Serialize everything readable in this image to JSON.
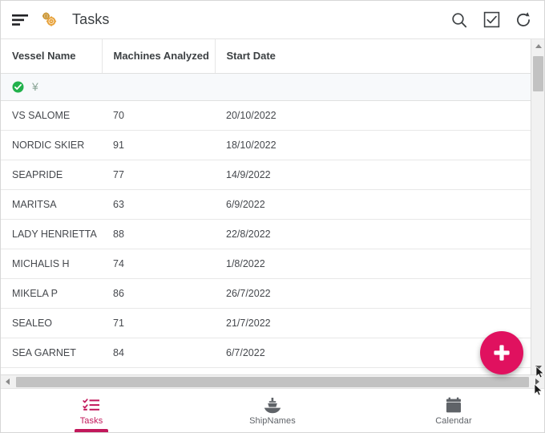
{
  "app_bar": {
    "title": "Tasks",
    "menu_icon": "sort-menu-icon",
    "logo_icon": "gears-icon",
    "actions": [
      {
        "name": "search-icon",
        "label": "Search"
      },
      {
        "name": "select-checkbox-icon",
        "label": "Select"
      },
      {
        "name": "refresh-icon",
        "label": "Refresh"
      }
    ]
  },
  "table": {
    "columns": [
      "Vessel Name",
      "Machines Analyzed",
      "Start Date"
    ],
    "filter_row": {
      "status_icon": "check-circle-icon",
      "currency_symbol": "¥"
    },
    "rows": [
      {
        "vessel": "VS SALOME",
        "machines": "70",
        "date": "20/10/2022"
      },
      {
        "vessel": "NORDIC SKIER",
        "machines": "91",
        "date": "18/10/2022"
      },
      {
        "vessel": "SEAPRIDE",
        "machines": "77",
        "date": "14/9/2022"
      },
      {
        "vessel": "MARITSA",
        "machines": "63",
        "date": "6/9/2022"
      },
      {
        "vessel": "LADY HENRIETTA",
        "machines": "88",
        "date": "22/8/2022"
      },
      {
        "vessel": "MICHALIS H",
        "machines": "74",
        "date": "1/8/2022"
      },
      {
        "vessel": "MIKELA P",
        "machines": "86",
        "date": "26/7/2022"
      },
      {
        "vessel": "SEALEO",
        "machines": "71",
        "date": "21/7/2022"
      },
      {
        "vessel": "SEA GARNET",
        "machines": "84",
        "date": "6/7/2022"
      }
    ]
  },
  "fab": {
    "name": "add-task-fab",
    "label": "+"
  },
  "bottom_nav": {
    "items": [
      {
        "label": "Tasks",
        "icon": "checklist-icon",
        "active": true
      },
      {
        "label": "ShipNames",
        "icon": "ship-icon",
        "active": false
      },
      {
        "label": "Calendar",
        "icon": "calendar-icon",
        "active": false
      }
    ]
  },
  "colors": {
    "accent": "#c2185b",
    "fab": "#e0115f",
    "status_green": "#22b14c",
    "gear": "#e8a33d",
    "text": "#3c4043"
  }
}
